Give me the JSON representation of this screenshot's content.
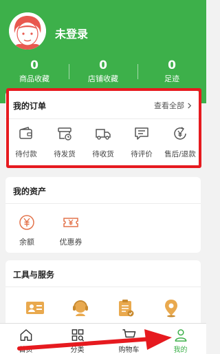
{
  "colors": {
    "brand": "#3db04a",
    "highlight": "#e61a1f",
    "accent": "#e3734b"
  },
  "header": {
    "username": "未登录"
  },
  "stats": [
    {
      "value": "0",
      "label": "商品收藏"
    },
    {
      "value": "0",
      "label": "店铺收藏"
    },
    {
      "value": "0",
      "label": "足迹"
    }
  ],
  "orders": {
    "title": "我的订单",
    "view_all": "查看全部",
    "items": [
      {
        "label": "待付款",
        "icon": "wallet-icon"
      },
      {
        "label": "待发货",
        "icon": "package-icon"
      },
      {
        "label": "待收货",
        "icon": "truck-icon"
      },
      {
        "label": "待评价",
        "icon": "comment-icon"
      },
      {
        "label": "售后/退款",
        "icon": "refund-icon"
      }
    ]
  },
  "assets": {
    "title": "我的资产",
    "items": [
      {
        "label": "余额",
        "icon": "yen-coin-icon"
      },
      {
        "label": "优惠券",
        "icon": "coupon-icon"
      }
    ]
  },
  "tools": {
    "title": "工具与服务",
    "items": [
      {
        "icon": "id-card-icon"
      },
      {
        "icon": "customer-service-icon"
      },
      {
        "icon": "clipboard-icon"
      },
      {
        "icon": "location-pin-icon"
      }
    ]
  },
  "tabbar": {
    "items": [
      {
        "label": "首页",
        "icon": "home-icon",
        "active": false
      },
      {
        "label": "分类",
        "icon": "category-icon",
        "active": false
      },
      {
        "label": "购物车",
        "icon": "cart-icon",
        "active": false
      },
      {
        "label": "我的",
        "icon": "person-icon",
        "active": true
      }
    ]
  }
}
